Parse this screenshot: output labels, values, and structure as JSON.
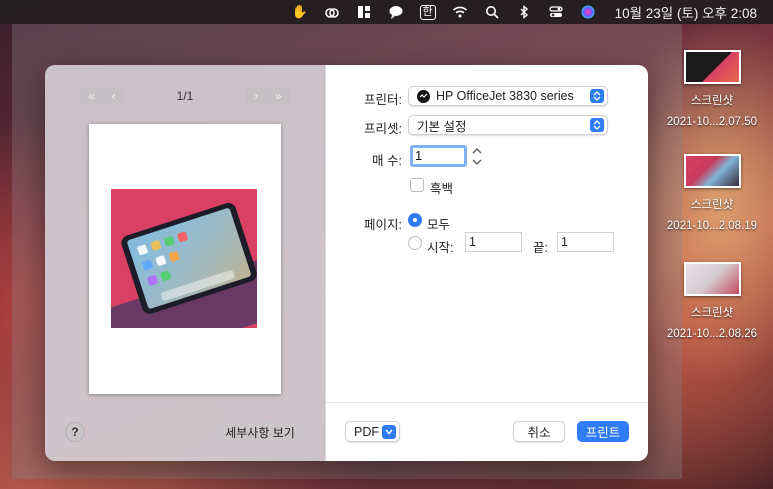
{
  "menubar": {
    "input_indicator": "한",
    "clock": "10월 23일 (토) 오후 2:08"
  },
  "print_dialog": {
    "preview": {
      "page_indicator": "1/1",
      "details_button": "세부사항 보기",
      "help_button": "?"
    },
    "printer": {
      "label": "프린터:",
      "value": "HP OfficeJet 3830 series"
    },
    "preset": {
      "label": "프리셋:",
      "value": "기본 설정"
    },
    "copies": {
      "label": "매 수:",
      "value": "1"
    },
    "black_white": {
      "label": "흑백",
      "checked": false
    },
    "pages": {
      "label": "페이지:",
      "all_label": "모두",
      "all_selected": true,
      "from_label": "시작:",
      "from_value": "1",
      "to_label": "끝:",
      "to_value": "1"
    },
    "pdf_button": "PDF",
    "cancel_button": "취소",
    "print_button": "프린트",
    "accent_color": "#2f7cf6"
  },
  "desktop": {
    "files": [
      {
        "name": "스크린샷",
        "sub": "2021-10...2.07.50"
      },
      {
        "name": "스크린샷",
        "sub": "2021-10...2.08.19"
      },
      {
        "name": "스크린샷",
        "sub": "2021-10...2.08.26"
      }
    ]
  }
}
